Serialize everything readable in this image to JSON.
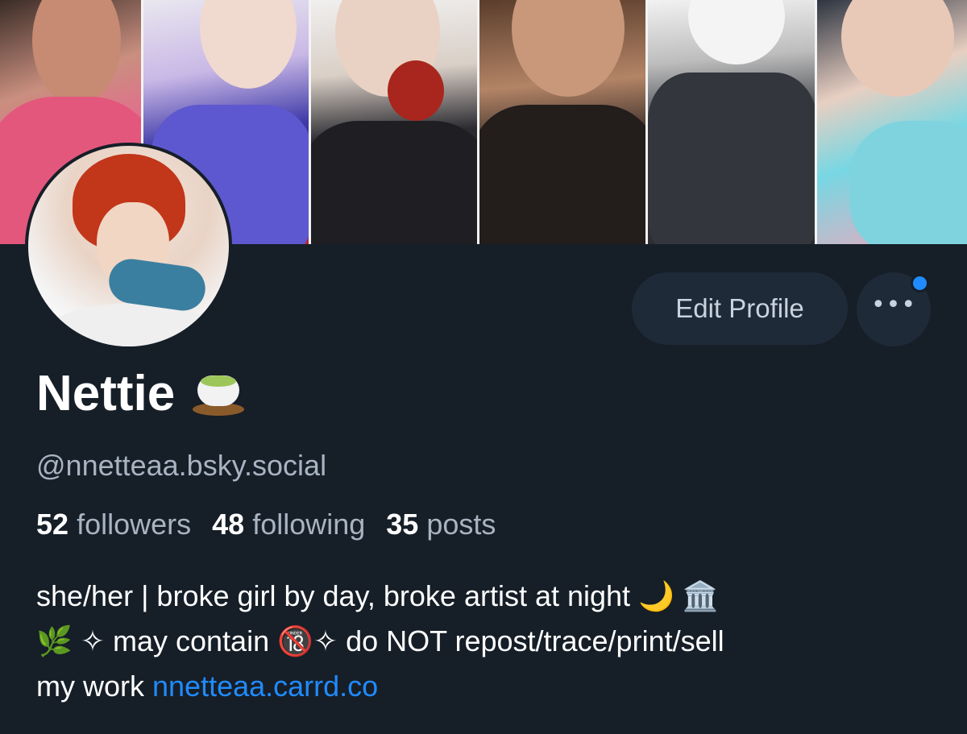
{
  "profile": {
    "display_name": "Nettie",
    "name_emoji": "tea-icon",
    "handle": "@nnetteaa.bsky.social",
    "stats": {
      "followers_count": "52",
      "followers_label": "followers",
      "following_count": "48",
      "following_label": "following",
      "posts_count": "35",
      "posts_label": "posts"
    },
    "bio": {
      "line1": "she/her | broke girl by day, broke artist at night 🌙 🏛️",
      "line2": "🌿 ✧ may contain 🔞✧ do NOT repost/trace/print/sell",
      "line3_prefix": "my work ",
      "link": "nnetteaa.carrd.co"
    }
  },
  "actions": {
    "edit_profile_label": "Edit Profile",
    "more_label": "•••"
  },
  "colors": {
    "background": "#161e27",
    "button_bg": "#1f2a38",
    "muted_text": "#a8b4c2",
    "link": "#208bfe",
    "notification_dot": "#208bfe"
  }
}
